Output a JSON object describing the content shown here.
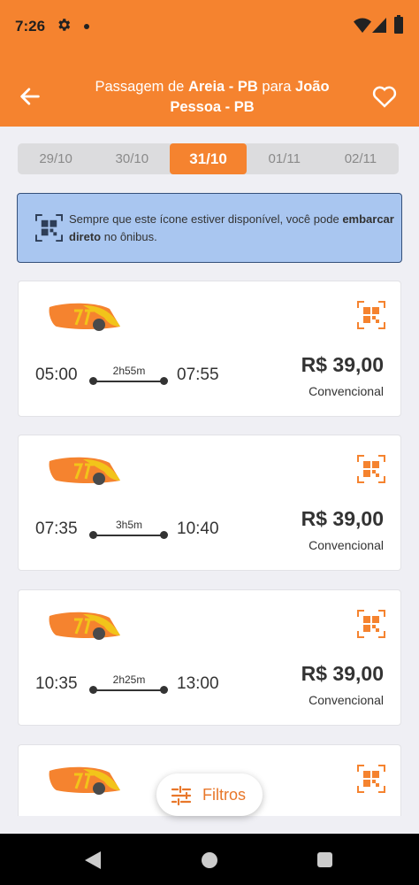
{
  "status_bar": {
    "time": "7:26"
  },
  "header": {
    "title_pre": "Passagem de",
    "origin": "Areia - PB",
    "title_mid": "para",
    "destination": "João Pessoa - PB"
  },
  "dates": [
    "29/10",
    "30/10",
    "31/10",
    "01/11",
    "02/11"
  ],
  "selected_date": "31/10",
  "info_banner": {
    "text_main": "Sempre que este ícone estiver disponível, você pode",
    "text_bold": "embarcar direto",
    "text_tail": "no ônibus."
  },
  "trips": [
    {
      "depart": "05:00",
      "duration": "2h55m",
      "arrive": "07:55",
      "price": "R$ 39,00",
      "class": "Convencional"
    },
    {
      "depart": "07:35",
      "duration": "3h5m",
      "arrive": "10:40",
      "price": "R$ 39,00",
      "class": "Convencional"
    },
    {
      "depart": "10:35",
      "duration": "2h25m",
      "arrive": "13:00",
      "price": "R$ 39,00",
      "class": "Convencional"
    }
  ],
  "filters_label": "Filtros",
  "colors": {
    "accent": "#f5832f",
    "banner_bg": "#a9c6f0",
    "banner_border": "#35507a"
  }
}
